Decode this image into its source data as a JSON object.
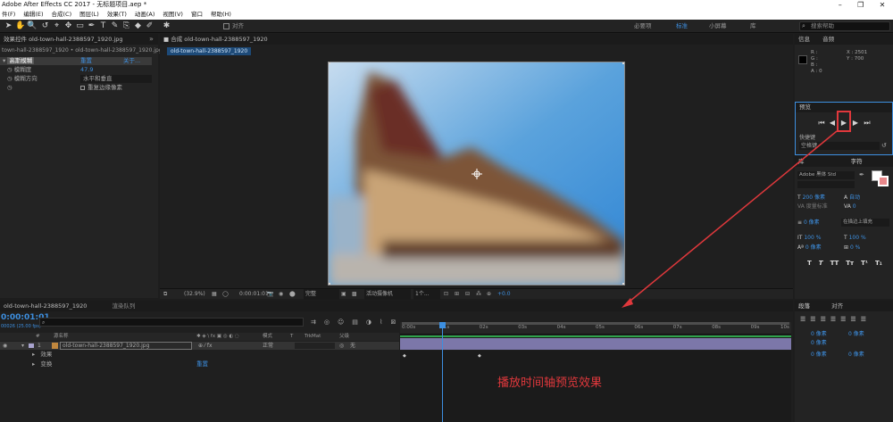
{
  "app": {
    "title": "Adobe After Effects CC 2017 - 无标题项目.aep *"
  },
  "menu": [
    "件(F)",
    "编辑(E)",
    "合成(C)",
    "图层(L)",
    "效果(T)",
    "动画(A)",
    "视图(V)",
    "窗口",
    "帮助(H)"
  ],
  "toolbar": {
    "align_label": "对齐",
    "workspaces": [
      "必要项",
      "标准",
      "小屏幕",
      "库"
    ],
    "search_placeholder": "搜索帮助"
  },
  "effects_panel": {
    "tab_label": "效果控件 old-town-hall-2388597_1920.jpg",
    "subtitle": "town-hall-2388597_1920 • old-town-hall-2388597_1920.jpg",
    "effect_name": "高斯模糊",
    "reset_label": "重置",
    "about_label": "关于...",
    "props": [
      {
        "name": "模糊度",
        "value": "47.9"
      },
      {
        "name": "模糊方向",
        "value": "水平和垂直"
      },
      {
        "name": "",
        "value": "重复边缘像素"
      }
    ]
  },
  "comp_panel": {
    "tab_label": "合成 old-town-hall-2388597_1920",
    "subtab": "old-town-hall-2388597_1920",
    "footer": {
      "zoom": "(32.9%)",
      "timecode": "0:00:01:01",
      "resolution": "完整",
      "camera": "活动摄像机",
      "views": "1个...",
      "exposure": "+0.0"
    }
  },
  "info_panel": {
    "tabs": [
      "信息",
      "音频"
    ],
    "channels": [
      "R :",
      "G :",
      "B :",
      "A : 0"
    ],
    "coords": [
      "X : 2501",
      "Y : 700"
    ]
  },
  "preview_panel": {
    "tab_label": "预览",
    "shortcut_label": "快捷键",
    "shortcut_value": "空格键"
  },
  "character_panel": {
    "tabs": [
      "库",
      "字符"
    ],
    "font_name": "Adobe 黑体 Std",
    "size": "200 像素",
    "leading": "自动",
    "tracking_label": "度量标准",
    "tracking_value": "0",
    "stroke_width": "0 像素",
    "stroke_type": "在描边上填充",
    "vscale": "100 %",
    "hscale": "100 %",
    "baseline": "0 像素",
    "tsume": "0 %",
    "styles": [
      "T",
      "T",
      "TT",
      "Tт",
      "T¹",
      "T₁"
    ]
  },
  "paragraph_panel": {
    "tabs": [
      "段落",
      "对齐"
    ],
    "values": [
      "0 像素",
      "0 像素",
      "0 像素",
      "0 像素",
      "0 像素"
    ]
  },
  "timeline": {
    "tab_label": "old-town-hall-2388597_1920",
    "render_queue_label": "渲染队列",
    "timecode": "0:00:01:01",
    "frame_info": "00026 (25.00 fps)",
    "search_placeholder": "",
    "col_headers": {
      "num": "#",
      "name": "源名称",
      "mode": "模式",
      "t": "T",
      "trkmat": "TrkMat",
      "parent": "父级"
    },
    "layer": {
      "number": "1",
      "name": "old-town-hall-2388597_1920.jpg",
      "mode": "正常",
      "parent": "无"
    },
    "sub_rows": [
      {
        "label": "效果",
        "value": ""
      },
      {
        "label": "变换",
        "value": "重置"
      }
    ],
    "ruler_ticks": [
      "0:00s",
      "01s",
      "02s",
      "03s",
      "04s",
      "05s",
      "06s",
      "07s",
      "08s",
      "09s",
      "10s"
    ],
    "playhead_seconds": 1.04,
    "duration_seconds": 10
  },
  "annotation": {
    "text": "播放时间轴预览效果",
    "color": "#e0383c"
  }
}
